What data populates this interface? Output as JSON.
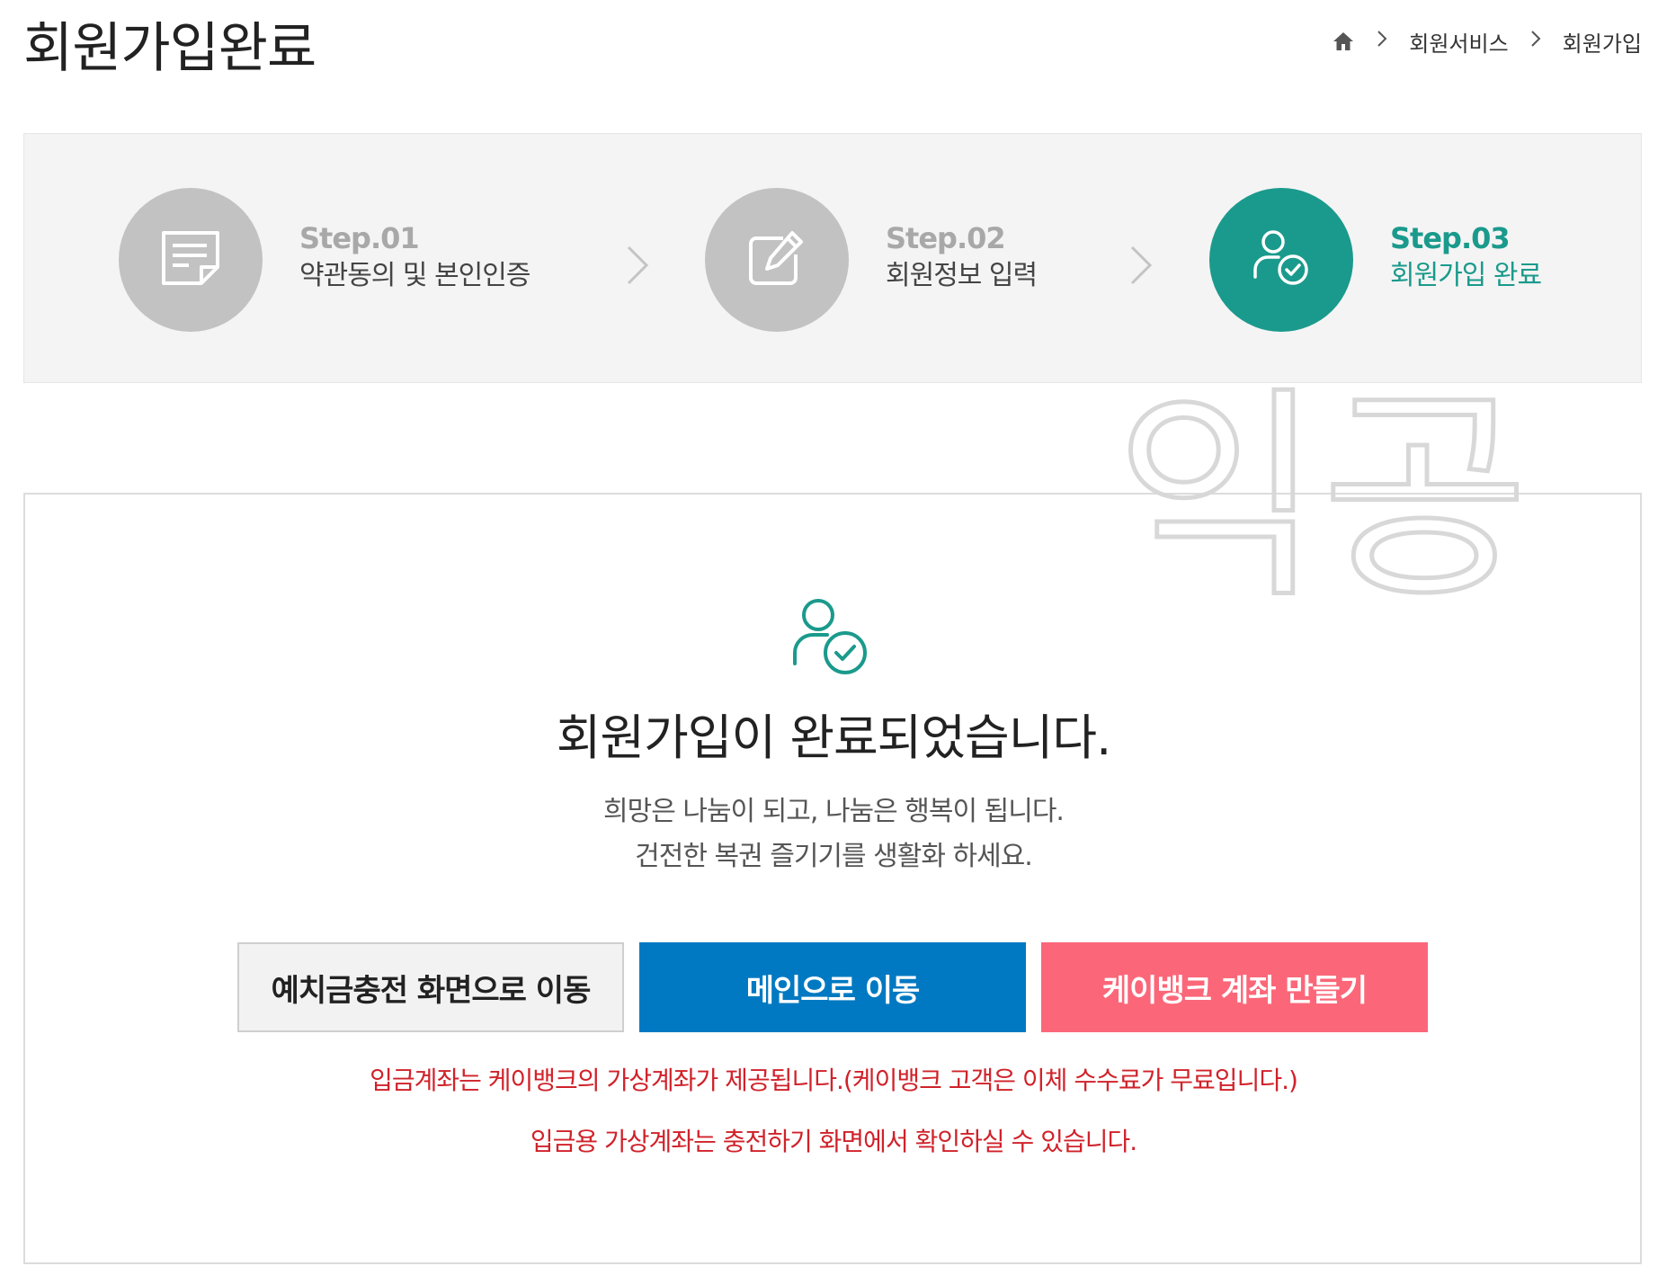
{
  "header": {
    "title": "회원가입완료",
    "breadcrumb": [
      "회원서비스",
      "회원가입"
    ]
  },
  "steps": [
    {
      "num": "Step.01",
      "label": "약관동의 및 본인인증",
      "icon": "document-icon",
      "active": false
    },
    {
      "num": "Step.02",
      "label": "회원정보 입력",
      "icon": "edit-icon",
      "active": false
    },
    {
      "num": "Step.03",
      "label": "회원가입 완료",
      "icon": "user-check-icon",
      "active": true
    }
  ],
  "watermark": "익공",
  "result": {
    "title": "회원가입이 완료되었습니다.",
    "sub_line1": "희망은 나눔이 되고, 나눔은 행복이 됩니다.",
    "sub_line2": "건전한 복권 즐기기를 생활화 하세요."
  },
  "buttons": {
    "deposit": "예치금충전 화면으로 이동",
    "main": "메인으로 이동",
    "kbank": "케이뱅크 계좌 만들기"
  },
  "notices": {
    "line1": "입금계좌는 케이뱅크의 가상계좌가 제공됩니다.(케이뱅크 고객은 이체 수수료가 무료입니다.)",
    "line2": "입금용 가상계좌는 충전하기 화면에서 확인하실 수 있습니다."
  },
  "colors": {
    "accent": "#1a9a8c",
    "inactive_step": "#c2c2c2",
    "primary_button": "#0079c2",
    "kbank_button": "#fb6779",
    "notice_text": "#d0222a"
  }
}
